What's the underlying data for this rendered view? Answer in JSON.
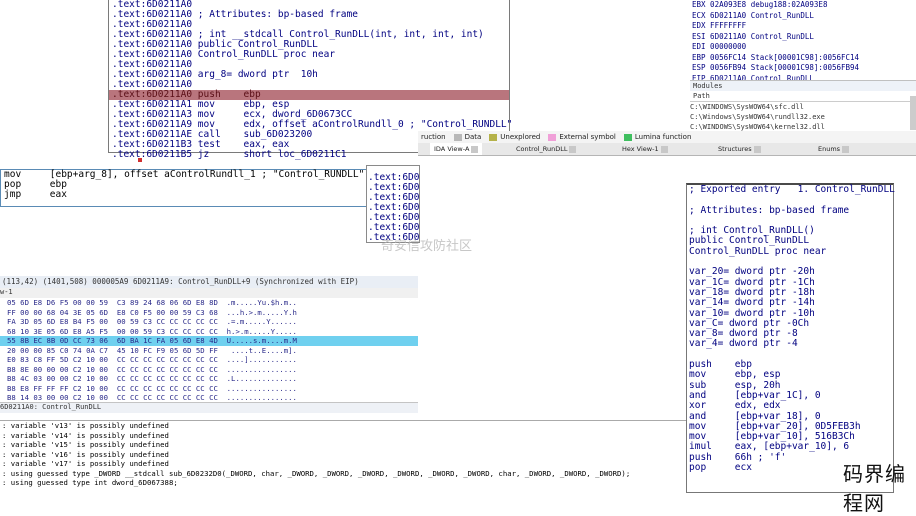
{
  "disasm_top": {
    "lines": [
      ".text:6D0211A0",
      ".text:6D0211A0 ; Attributes: bp-based frame",
      ".text:6D0211A0",
      ".text:6D0211A0 ; int __stdcall Control_RunDLL(int, int, int, int)",
      ".text:6D0211A0 public Control_RunDLL",
      ".text:6D0211A0 Control_RunDLL proc near",
      ".text:6D0211A0",
      ".text:6D0211A0 arg_8= dword ptr  10h",
      ".text:6D0211A0",
      ".text:6D0211A0 push    ebp",
      ".text:6D0211A1 mov     ebp, esp",
      ".text:6D0211A3 mov     ecx, dword_6D0673CC",
      ".text:6D0211A9 mov     edx, offset aControlRundll_0 ; \"Control_RUNDLL\"",
      ".text:6D0211AE call    sub_6D023200",
      ".text:6D0211B3 test    eax, eax",
      ".text:6D0211B5 jz      short loc_6D0211C1"
    ]
  },
  "registers": {
    "lines": [
      "EBX 02A093E8 debug188:02A093E8",
      "ECX 6D0211A0 Control_RunDLL",
      "EDX FFFFFFFF",
      "ESI 6D0211A0 Control_RunDLL",
      "EDI 00000000",
      "EBP 0056FC14 Stack[00001C98]:0056FC14",
      "ESP 0056FB94 Stack[00001C98]:0056FB94",
      "EIP 6D0211A0 Control_RunDLL"
    ]
  },
  "modules": {
    "title": "Modules",
    "header": "Path",
    "items": [
      "C:\\WINDOWS\\SysWOW64\\sfc.dll",
      "C:\\Windows\\SysWOW64\\rundll32.exe",
      "C:\\WINDOWS\\SysWOW64\\kernel32.dll"
    ]
  },
  "ida_mid_left": {
    "lines": [
      "mov     [ebp+arg_8], offset aControlRundll_1 ; \"Control_RUNDLL\"",
      "pop     ebp",
      "jmp     eax"
    ]
  },
  "small_panel": {
    "lines": [
      ".text:6D0",
      ".text:6D0",
      ".text:6D0",
      ".text:6D0",
      ".text:6D0",
      ".text:6D0",
      ".text:6D0"
    ]
  },
  "status_bar": "(113,42) (1401,508) 000005A9 6D0211A9: Control_RunDLL+9 (Synchronized with EIP)",
  "hex_view": {
    "title": "w-1",
    "rows": [
      "05 6D E8 D6 F5 00 00 59  C3 89 24 68 06 6D E8 8D  .m.....Yu.$h.m..",
      "FF 00 00 68 04 3E 05 6D  E8 C0 F5 00 00 59 C3 68  ...h.>.m.....Y.h",
      "FA 3D 05 6D E8 B4 F5 00  00 59 C3 CC CC CC CC CC  .=.m.....Y......",
      "68 10 3E 05 6D E8 A5 F5  00 00 59 C3 CC CC CC CC  h.>.m.....Y.....",
      "55 8B EC 8B 0D CC 73 06  6D BA 1C FA 05 6D E8 4D  U.....s.m....m.M",
      "20 00 00 85 C0 74 0A C7  45 10 FC F9 05 6D 5D FF   ....t..E....m].",
      "E0 83 C8 FF 5D C2 10 00  CC CC CC CC CC CC CC CC  ....]...........",
      "B8 8E 00 00 00 C2 10 00  CC CC CC CC CC CC CC CC  ................",
      "B8 4C 03 00 00 C2 10 00  CC CC CC CC CC CC CC CC  .L..............",
      "B8 E8 FF FF FF C2 10 00  CC CC CC CC CC CC CC CC  ................",
      "B8 14 03 00 00 C2 10 00  CC CC CC CC CC CC CC CC  ................"
    ],
    "footer": "6D0211A0: Control_RunDLL"
  },
  "output": {
    "lines": [
      ": variable 'v13' is possibly undefined",
      ": variable 'v14' is possibly undefined",
      ": variable 'v15' is possibly undefined",
      ": variable 'v16' is possibly undefined",
      ": variable 'v17' is possibly undefined",
      ": using guessed type _DWORD __stdcall sub_6D0232D0(_DWORD, char, _DWORD, _DWORD, _DWORD, _DWORD, _DWORD, _DWORD, char, _DWORD, _DWORD, _DWORD);",
      ": using guessed type int dword_6D067388;"
    ]
  },
  "legend": {
    "items": [
      {
        "label": "ruction",
        "color": ""
      },
      {
        "label": "Data",
        "color": "#b8b8b8"
      },
      {
        "label": "Unexplored",
        "color": "#b5b24a"
      },
      {
        "label": "External symbol",
        "color": "#f0a0d8"
      },
      {
        "label": "Lumina function",
        "color": "#3fbf5f"
      }
    ]
  },
  "tabs": [
    {
      "label": "IDA View-A",
      "active": true
    },
    {
      "label": "Control_RunDLL",
      "active": false
    },
    {
      "label": "Hex View-1",
      "active": false
    },
    {
      "label": "Structures",
      "active": false
    },
    {
      "label": "Enums",
      "active": false
    }
  ],
  "ida_right": {
    "lines": [
      "; Exported entry   1. Control_RunDLL",
      "",
      "; Attributes: bp-based frame",
      "",
      "; int Control_RunDLL()",
      "public Control_RunDLL",
      "Control_RunDLL proc near",
      "",
      "var_20= dword ptr -20h",
      "var_1C= dword ptr -1Ch",
      "var_18= dword ptr -18h",
      "var_14= dword ptr -14h",
      "var_10= dword ptr -10h",
      "var_C= dword ptr -0Ch",
      "var_8= dword ptr -8",
      "var_4= dword ptr -4",
      "",
      "push    ebp",
      "mov     ebp, esp",
      "sub     esp, 20h",
      "and     [ebp+var_1C], 0",
      "xor     edx, edx",
      "and     [ebp+var_18], 0",
      "mov     [ebp+var_20], 0D5FEB3h",
      "mov     [ebp+var_10], 516B3Ch",
      "imul    eax, [ebp+var_10], 6",
      "push    66h ; 'f'",
      "pop     ecx"
    ]
  },
  "watermark": "奇安信攻防社区",
  "logo": "码界编程网"
}
